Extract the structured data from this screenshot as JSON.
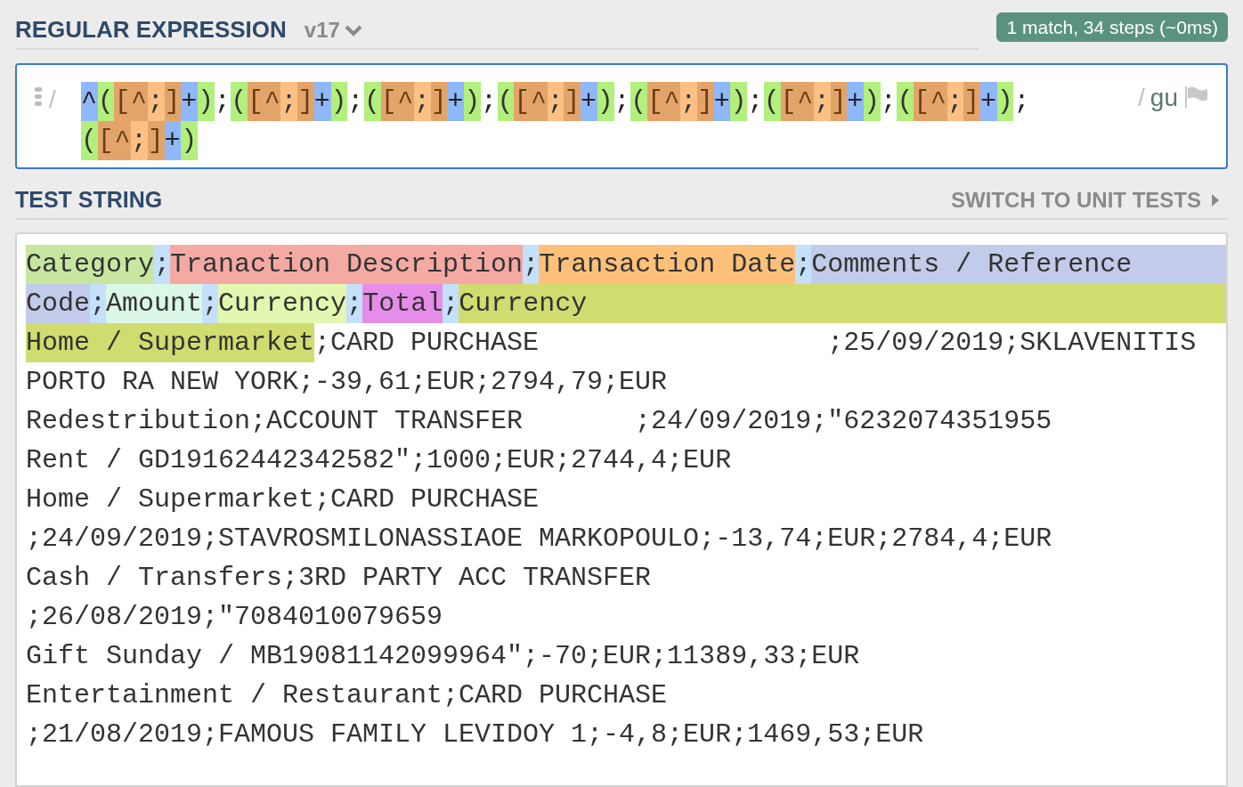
{
  "regex_header": {
    "title": "REGULAR EXPRESSION",
    "version": "v17",
    "match_info": "1 match, 34 steps (~0ms)"
  },
  "regex": {
    "open_delimiter": "/",
    "close_delimiter": "/",
    "flags": "gu",
    "lines": [
      [
        {
          "t": "^",
          "kind": "anchor"
        },
        {
          "t": "(",
          "kind": "group"
        },
        {
          "t": "[^",
          "kind": "set"
        },
        {
          "t": ";",
          "kind": "set-char"
        },
        {
          "t": "]",
          "kind": "set"
        },
        {
          "t": "+",
          "kind": "quantifier"
        },
        {
          "t": ")",
          "kind": "group"
        },
        {
          "t": ";",
          "kind": "literal"
        },
        {
          "t": "(",
          "kind": "group"
        },
        {
          "t": "[^",
          "kind": "set"
        },
        {
          "t": ";",
          "kind": "set-char"
        },
        {
          "t": "]",
          "kind": "set"
        },
        {
          "t": "+",
          "kind": "quantifier"
        },
        {
          "t": ")",
          "kind": "group"
        },
        {
          "t": ";",
          "kind": "literal"
        },
        {
          "t": "(",
          "kind": "group"
        },
        {
          "t": "[^",
          "kind": "set"
        },
        {
          "t": ";",
          "kind": "set-char"
        },
        {
          "t": "]",
          "kind": "set"
        },
        {
          "t": "+",
          "kind": "quantifier"
        },
        {
          "t": ")",
          "kind": "group"
        },
        {
          "t": ";",
          "kind": "literal"
        },
        {
          "t": "(",
          "kind": "group"
        },
        {
          "t": "[^",
          "kind": "set"
        },
        {
          "t": ";",
          "kind": "set-char"
        },
        {
          "t": "]",
          "kind": "set"
        },
        {
          "t": "+",
          "kind": "quantifier"
        },
        {
          "t": ")",
          "kind": "group"
        },
        {
          "t": ";",
          "kind": "literal"
        },
        {
          "t": "(",
          "kind": "group"
        },
        {
          "t": "[^",
          "kind": "set"
        },
        {
          "t": ";",
          "kind": "set-char"
        },
        {
          "t": "]",
          "kind": "set"
        },
        {
          "t": "+",
          "kind": "quantifier"
        },
        {
          "t": ")",
          "kind": "group"
        },
        {
          "t": ";",
          "kind": "literal"
        },
        {
          "t": "(",
          "kind": "group"
        },
        {
          "t": "[^",
          "kind": "set"
        },
        {
          "t": ";",
          "kind": "set-char"
        },
        {
          "t": "]",
          "kind": "set"
        },
        {
          "t": "+",
          "kind": "quantifier"
        },
        {
          "t": ")",
          "kind": "group"
        },
        {
          "t": ";",
          "kind": "literal"
        },
        {
          "t": "(",
          "kind": "group"
        },
        {
          "t": "[^",
          "kind": "set"
        },
        {
          "t": ";",
          "kind": "set-char"
        },
        {
          "t": "]",
          "kind": "set"
        },
        {
          "t": "+",
          "kind": "quantifier"
        },
        {
          "t": ")",
          "kind": "group"
        },
        {
          "t": ";",
          "kind": "literal"
        }
      ],
      [
        {
          "t": "(",
          "kind": "group"
        },
        {
          "t": "[^",
          "kind": "set"
        },
        {
          "t": ";",
          "kind": "set-char"
        },
        {
          "t": "]",
          "kind": "set"
        },
        {
          "t": "+",
          "kind": "quantifier"
        },
        {
          "t": ")",
          "kind": "group"
        }
      ]
    ]
  },
  "test_header": {
    "title": "TEST STRING",
    "switch_link": "SWITCH TO UNIT TESTS"
  },
  "test_string": {
    "lines": [
      [
        {
          "t": "Category",
          "color": "#c8e6a0"
        },
        {
          "t": ";",
          "color": "#c4e0fb"
        },
        {
          "t": "Tranaction Description",
          "color": "#f5a9a3"
        },
        {
          "t": ";",
          "color": "#c4e0fb"
        },
        {
          "t": "Transaction Date",
          "color": "#ffc07a"
        },
        {
          "t": ";",
          "color": "#c4e0fb"
        },
        {
          "t": "Comments / Reference",
          "color": "#c2cbe9"
        }
      ],
      [
        {
          "t": "Code",
          "color": "#c2cbe9"
        },
        {
          "t": ";",
          "color": "#c4e0fb"
        },
        {
          "t": "Amount",
          "color": "#daf7e8"
        },
        {
          "t": ";",
          "color": "#c4e0fb"
        },
        {
          "t": "Currency",
          "color": "#e2f7b0"
        },
        {
          "t": ";",
          "color": "#c4e0fb"
        },
        {
          "t": "Total",
          "color": "#e68de9"
        },
        {
          "t": ";",
          "color": "#c4e0fb"
        },
        {
          "t": "Currency",
          "color": "#d0dc70"
        }
      ],
      [
        {
          "t": "Home / Supermarket",
          "color": "#d0dc70"
        },
        {
          "t": ";CARD PURCHASE                  ;25/09/2019;SKLAVENITIS"
        }
      ],
      [
        {
          "t": "PORTO RA NEW YORK;-39,61;EUR;2794,79;EUR"
        }
      ],
      [
        {
          "t": "Redestribution;ACCOUNT TRANSFER       ;24/09/2019;\"6232074351955"
        }
      ],
      [
        {
          "t": "Rent / GD19162442342582\";1000;EUR;2744,4;EUR"
        }
      ],
      [
        {
          "t": "Home / Supermarket;CARD PURCHASE"
        }
      ],
      [
        {
          "t": ";24/09/2019;STAVROSMILONASSIAOE MARKOPOULO;-13,74;EUR;2784,4;EUR"
        }
      ],
      [
        {
          "t": "Cash / Transfers;3RD PARTY ACC TRANSFER"
        }
      ],
      [
        {
          "t": ";26/08/2019;\"7084010079659"
        }
      ],
      [
        {
          "t": "Gift Sunday / MB19081142099964\";-70;EUR;11389,33;EUR"
        }
      ],
      [
        {
          "t": "Entertainment / Restaurant;CARD PURCHASE"
        }
      ],
      [
        {
          "t": ";21/08/2019;FAMOUS FAMILY LEVIDOY 1;-4,8;EUR;1469,53;EUR"
        }
      ]
    ]
  }
}
